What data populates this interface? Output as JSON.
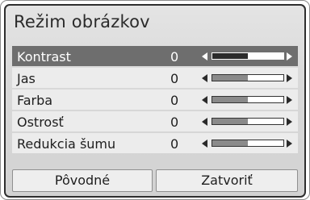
{
  "dialog": {
    "title": "Režim obrázkov"
  },
  "settings": [
    {
      "label": "Kontrast",
      "value": "0",
      "level": 0.5
    },
    {
      "label": "Jas",
      "value": "0",
      "level": 0.5
    },
    {
      "label": "Farba",
      "value": "0",
      "level": 0.5
    },
    {
      "label": "Ostrosť",
      "value": "0",
      "level": 0.5
    },
    {
      "label": "Redukcia šumu",
      "value": "0",
      "level": 0.5
    }
  ],
  "buttons": {
    "reset": "Pôvodné",
    "close": "Zatvoriť"
  }
}
